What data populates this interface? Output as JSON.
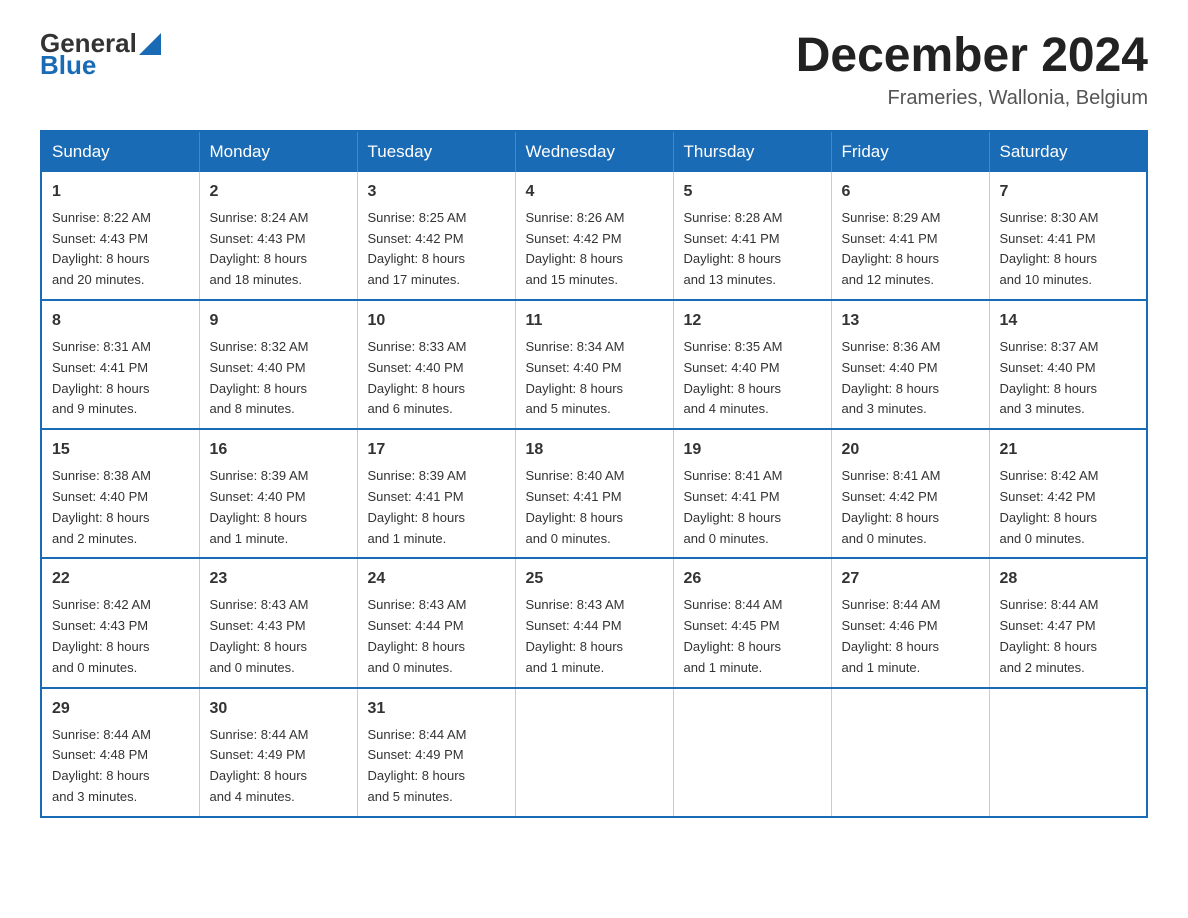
{
  "header": {
    "logo_general": "General",
    "logo_blue": "Blue",
    "month_title": "December 2024",
    "location": "Frameries, Wallonia, Belgium"
  },
  "days_of_week": [
    "Sunday",
    "Monday",
    "Tuesday",
    "Wednesday",
    "Thursday",
    "Friday",
    "Saturday"
  ],
  "weeks": [
    [
      {
        "num": "1",
        "sunrise": "8:22 AM",
        "sunset": "4:43 PM",
        "daylight": "8 hours and 20 minutes."
      },
      {
        "num": "2",
        "sunrise": "8:24 AM",
        "sunset": "4:43 PM",
        "daylight": "8 hours and 18 minutes."
      },
      {
        "num": "3",
        "sunrise": "8:25 AM",
        "sunset": "4:42 PM",
        "daylight": "8 hours and 17 minutes."
      },
      {
        "num": "4",
        "sunrise": "8:26 AM",
        "sunset": "4:42 PM",
        "daylight": "8 hours and 15 minutes."
      },
      {
        "num": "5",
        "sunrise": "8:28 AM",
        "sunset": "4:41 PM",
        "daylight": "8 hours and 13 minutes."
      },
      {
        "num": "6",
        "sunrise": "8:29 AM",
        "sunset": "4:41 PM",
        "daylight": "8 hours and 12 minutes."
      },
      {
        "num": "7",
        "sunrise": "8:30 AM",
        "sunset": "4:41 PM",
        "daylight": "8 hours and 10 minutes."
      }
    ],
    [
      {
        "num": "8",
        "sunrise": "8:31 AM",
        "sunset": "4:41 PM",
        "daylight": "8 hours and 9 minutes."
      },
      {
        "num": "9",
        "sunrise": "8:32 AM",
        "sunset": "4:40 PM",
        "daylight": "8 hours and 8 minutes."
      },
      {
        "num": "10",
        "sunrise": "8:33 AM",
        "sunset": "4:40 PM",
        "daylight": "8 hours and 6 minutes."
      },
      {
        "num": "11",
        "sunrise": "8:34 AM",
        "sunset": "4:40 PM",
        "daylight": "8 hours and 5 minutes."
      },
      {
        "num": "12",
        "sunrise": "8:35 AM",
        "sunset": "4:40 PM",
        "daylight": "8 hours and 4 minutes."
      },
      {
        "num": "13",
        "sunrise": "8:36 AM",
        "sunset": "4:40 PM",
        "daylight": "8 hours and 3 minutes."
      },
      {
        "num": "14",
        "sunrise": "8:37 AM",
        "sunset": "4:40 PM",
        "daylight": "8 hours and 3 minutes."
      }
    ],
    [
      {
        "num": "15",
        "sunrise": "8:38 AM",
        "sunset": "4:40 PM",
        "daylight": "8 hours and 2 minutes."
      },
      {
        "num": "16",
        "sunrise": "8:39 AM",
        "sunset": "4:40 PM",
        "daylight": "8 hours and 1 minute."
      },
      {
        "num": "17",
        "sunrise": "8:39 AM",
        "sunset": "4:41 PM",
        "daylight": "8 hours and 1 minute."
      },
      {
        "num": "18",
        "sunrise": "8:40 AM",
        "sunset": "4:41 PM",
        "daylight": "8 hours and 0 minutes."
      },
      {
        "num": "19",
        "sunrise": "8:41 AM",
        "sunset": "4:41 PM",
        "daylight": "8 hours and 0 minutes."
      },
      {
        "num": "20",
        "sunrise": "8:41 AM",
        "sunset": "4:42 PM",
        "daylight": "8 hours and 0 minutes."
      },
      {
        "num": "21",
        "sunrise": "8:42 AM",
        "sunset": "4:42 PM",
        "daylight": "8 hours and 0 minutes."
      }
    ],
    [
      {
        "num": "22",
        "sunrise": "8:42 AM",
        "sunset": "4:43 PM",
        "daylight": "8 hours and 0 minutes."
      },
      {
        "num": "23",
        "sunrise": "8:43 AM",
        "sunset": "4:43 PM",
        "daylight": "8 hours and 0 minutes."
      },
      {
        "num": "24",
        "sunrise": "8:43 AM",
        "sunset": "4:44 PM",
        "daylight": "8 hours and 0 minutes."
      },
      {
        "num": "25",
        "sunrise": "8:43 AM",
        "sunset": "4:44 PM",
        "daylight": "8 hours and 1 minute."
      },
      {
        "num": "26",
        "sunrise": "8:44 AM",
        "sunset": "4:45 PM",
        "daylight": "8 hours and 1 minute."
      },
      {
        "num": "27",
        "sunrise": "8:44 AM",
        "sunset": "4:46 PM",
        "daylight": "8 hours and 1 minute."
      },
      {
        "num": "28",
        "sunrise": "8:44 AM",
        "sunset": "4:47 PM",
        "daylight": "8 hours and 2 minutes."
      }
    ],
    [
      {
        "num": "29",
        "sunrise": "8:44 AM",
        "sunset": "4:48 PM",
        "daylight": "8 hours and 3 minutes."
      },
      {
        "num": "30",
        "sunrise": "8:44 AM",
        "sunset": "4:49 PM",
        "daylight": "8 hours and 4 minutes."
      },
      {
        "num": "31",
        "sunrise": "8:44 AM",
        "sunset": "4:49 PM",
        "daylight": "8 hours and 5 minutes."
      },
      null,
      null,
      null,
      null
    ]
  ],
  "labels": {
    "sunrise": "Sunrise:",
    "sunset": "Sunset:",
    "daylight": "Daylight:"
  }
}
